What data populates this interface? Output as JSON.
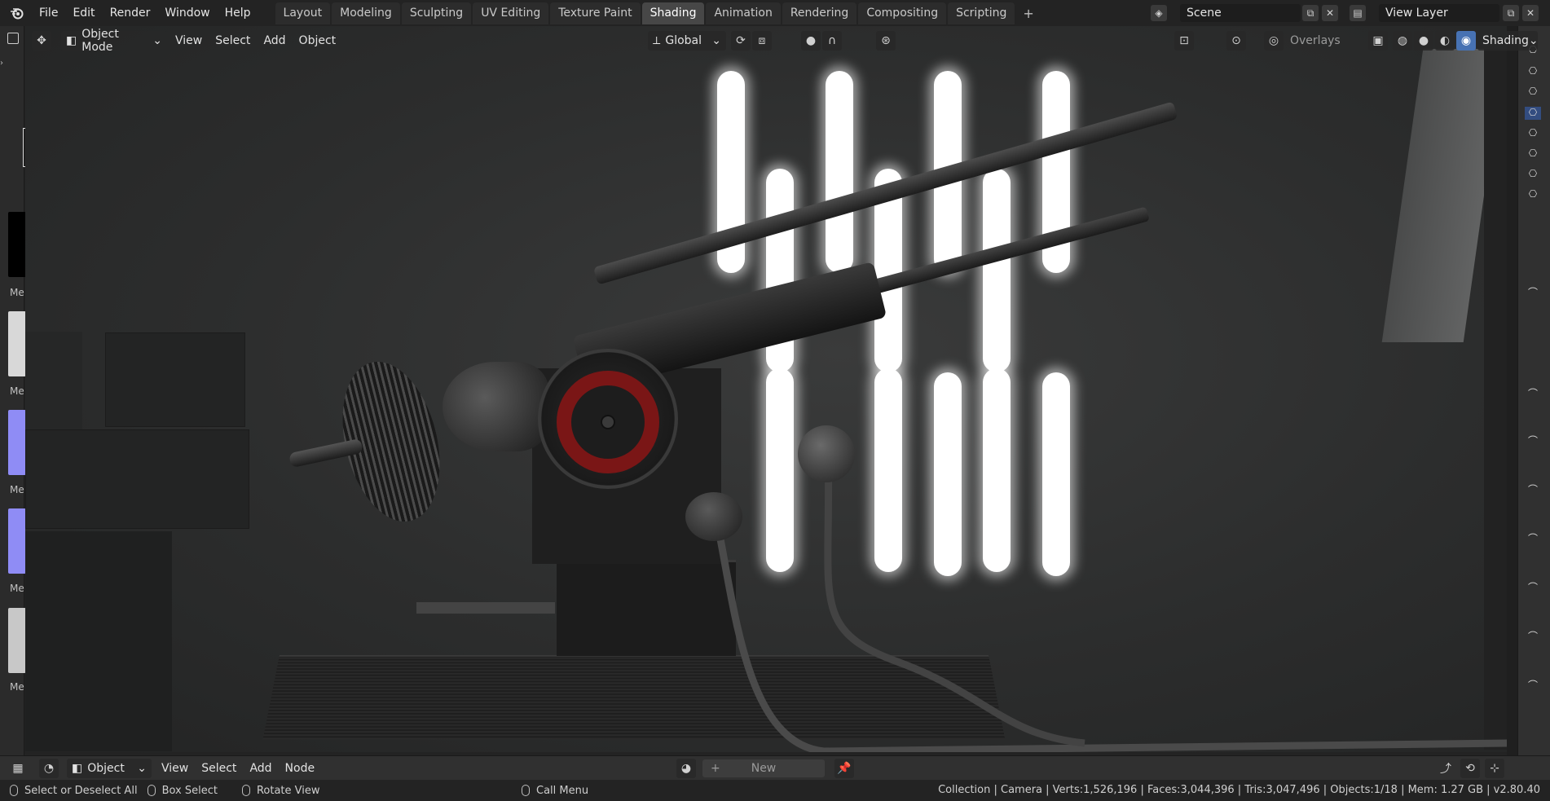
{
  "app": {
    "name": "Blender",
    "version": "v2.80.40"
  },
  "menu": [
    "File",
    "Edit",
    "Render",
    "Window",
    "Help"
  ],
  "workspaces": [
    {
      "label": "Layout",
      "active": false
    },
    {
      "label": "Modeling",
      "active": false
    },
    {
      "label": "Sculpting",
      "active": false
    },
    {
      "label": "UV Editing",
      "active": false
    },
    {
      "label": "Texture Paint",
      "active": false
    },
    {
      "label": "Shading",
      "active": true
    },
    {
      "label": "Animation",
      "active": false
    },
    {
      "label": "Rendering",
      "active": false
    },
    {
      "label": "Compositing",
      "active": false
    },
    {
      "label": "Scripting",
      "active": false
    }
  ],
  "scene": {
    "name": "Scene",
    "view_layer": "View Layer"
  },
  "viewport_header": {
    "mode": "Object Mode",
    "menus": [
      "View",
      "Select",
      "Add",
      "Object"
    ],
    "orientation": "Global",
    "overlays_label": "Overlays",
    "shading_label": "Shading"
  },
  "left_thumbs": [
    {
      "label": "Me",
      "color": "#000000"
    },
    {
      "label": "Me",
      "color": "#d8d8d8"
    },
    {
      "label": "Me",
      "color": "#8f8cf5"
    },
    {
      "label": "Me",
      "color": "#8f8cf5"
    },
    {
      "label": "Me",
      "color": "#c8c8c8"
    }
  ],
  "node_editor": {
    "editor": "Object",
    "menus": [
      "View",
      "Select",
      "Add",
      "Node"
    ],
    "new_label": "New"
  },
  "status": {
    "hints": [
      "Select or Deselect All",
      "Box Select",
      "Rotate View",
      "Call Menu"
    ],
    "stats": "Collection | Camera | Verts:1,526,196 | Faces:3,044,396 | Tris:3,047,496 | Objects:1/18 | Mem: 1.27 GB | v2.80.40"
  },
  "colors": {
    "accent": "#4772b3",
    "active_tab": "#474747",
    "target_ring": "#7a1616"
  }
}
